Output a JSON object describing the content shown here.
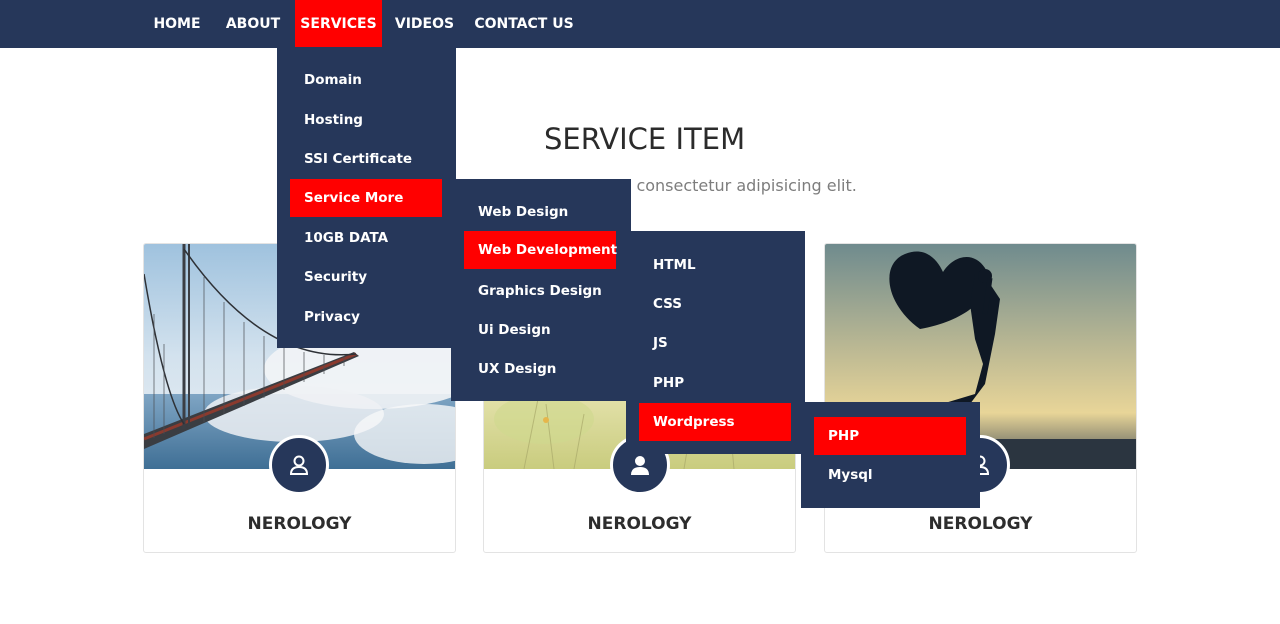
{
  "nav": {
    "items": [
      {
        "label": "HOME",
        "active": false
      },
      {
        "label": "ABOUT",
        "active": false
      },
      {
        "label": "SERVICES",
        "active": true
      },
      {
        "label": "VIDEOS",
        "active": false
      },
      {
        "label": "CONTACT US",
        "active": false
      }
    ]
  },
  "services_menu": {
    "items": [
      {
        "label": "Domain"
      },
      {
        "label": "Hosting"
      },
      {
        "label": "SSI Certificate"
      },
      {
        "label": "Service More",
        "active": true
      },
      {
        "label": "10GB DATA"
      },
      {
        "label": "Security"
      },
      {
        "label": "Privacy"
      }
    ]
  },
  "more_menu": {
    "items": [
      {
        "label": "Web Design"
      },
      {
        "label": "Web Development",
        "active": true
      },
      {
        "label": "Graphics Design"
      },
      {
        "label": "Ui Design"
      },
      {
        "label": "UX Design"
      }
    ]
  },
  "dev_menu": {
    "items": [
      {
        "label": "HTML"
      },
      {
        "label": "CSS"
      },
      {
        "label": "JS"
      },
      {
        "label": "PHP"
      },
      {
        "label": "Wordpress",
        "active": true
      }
    ]
  },
  "wp_menu": {
    "items": [
      {
        "label": "PHP",
        "active": true
      },
      {
        "label": "Mysql"
      }
    ]
  },
  "section": {
    "title": "SERVICE ITEM",
    "subtitle_visible": "t, consectetur adipisicing elit."
  },
  "cards": [
    {
      "title": "NEROLOGY",
      "icon": "user-outline-icon"
    },
    {
      "title": "NEROLOGY",
      "icon": "user-filled-icon"
    },
    {
      "title": "NEROLOGY",
      "icon": "user-outline-icon"
    }
  ],
  "colors": {
    "navy": "#26375a",
    "accent": "#ff0000",
    "text_dark": "#2d2d2d",
    "text_muted": "#7d7d7d"
  }
}
